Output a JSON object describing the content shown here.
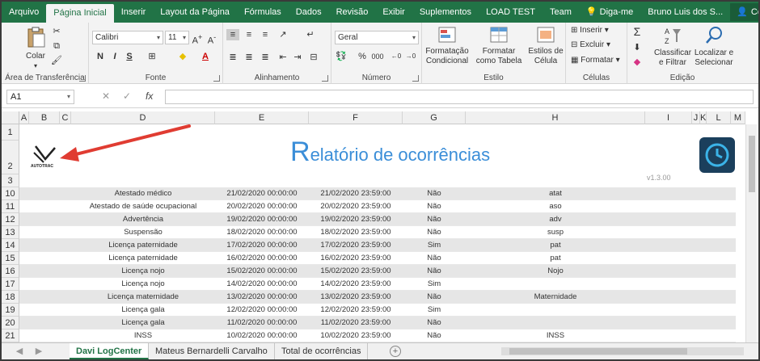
{
  "menu": {
    "tabs": [
      "Arquivo",
      "Página Inicial",
      "Inserir",
      "Layout da Página",
      "Fórmulas",
      "Dados",
      "Revisão",
      "Exibir",
      "Suplementos",
      "LOAD TEST",
      "Team"
    ],
    "tell_me": "Diga-me",
    "user": "Bruno Luis dos S...",
    "share": "Compartilhar"
  },
  "ribbon": {
    "clipboard": {
      "paste": "Colar",
      "label": "Área de Transferência"
    },
    "font": {
      "name": "Calibri",
      "size": "11",
      "bold": "N",
      "italic": "I",
      "underline": "S",
      "label": "Fonte"
    },
    "alignment": {
      "label": "Alinhamento"
    },
    "number": {
      "format": "Geral",
      "percent": "%",
      "thousands": "000",
      "label": "Número"
    },
    "styles": {
      "conditional": "Formatação Condicional",
      "table": "Formatar como Tabela",
      "cell": "Estilos de Célula",
      "label": "Estilo"
    },
    "cells": {
      "insert": "Inserir",
      "delete": "Excluir",
      "format": "Formatar",
      "label": "Células"
    },
    "editing": {
      "sort": "Classificar e Filtrar",
      "find": "Localizar e Selecionar",
      "label": "Edição"
    }
  },
  "formula_bar": {
    "name_box": "A1",
    "fx": "fx",
    "value": ""
  },
  "columns": [
    "A",
    "B",
    "C",
    "D",
    "E",
    "F",
    "G",
    "H",
    "I",
    "J",
    "K",
    "L",
    "M"
  ],
  "report": {
    "title_first": "R",
    "title_rest": "elatório de ocorrências",
    "version": "v1.3.00",
    "logo_text": "AUTOTRAC"
  },
  "header_rows": [
    "1",
    "2",
    "3"
  ],
  "rows": [
    {
      "n": "10",
      "d": "Atestado médico",
      "e": "21/02/2020 00:00:00",
      "f": "21/02/2020 23:59:00",
      "g": "Não",
      "h": "atat"
    },
    {
      "n": "11",
      "d": "Atestado de saúde ocupacional",
      "e": "20/02/2020 00:00:00",
      "f": "20/02/2020 23:59:00",
      "g": "Não",
      "h": "aso"
    },
    {
      "n": "12",
      "d": "Advertência",
      "e": "19/02/2020 00:00:00",
      "f": "19/02/2020 23:59:00",
      "g": "Não",
      "h": "adv"
    },
    {
      "n": "13",
      "d": "Suspensão",
      "e": "18/02/2020 00:00:00",
      "f": "18/02/2020 23:59:00",
      "g": "Não",
      "h": "susp"
    },
    {
      "n": "14",
      "d": "Licença paternidade",
      "e": "17/02/2020 00:00:00",
      "f": "17/02/2020 23:59:00",
      "g": "Sim",
      "h": "pat"
    },
    {
      "n": "15",
      "d": "Licença paternidade",
      "e": "16/02/2020 00:00:00",
      "f": "16/02/2020 23:59:00",
      "g": "Não",
      "h": "pat"
    },
    {
      "n": "16",
      "d": "Licença nojo",
      "e": "15/02/2020 00:00:00",
      "f": "15/02/2020 23:59:00",
      "g": "Não",
      "h": "Nojo"
    },
    {
      "n": "17",
      "d": "Licença nojo",
      "e": "14/02/2020 00:00:00",
      "f": "14/02/2020 23:59:00",
      "g": "Sim",
      "h": ""
    },
    {
      "n": "18",
      "d": "Licença maternidade",
      "e": "13/02/2020 00:00:00",
      "f": "13/02/2020 23:59:00",
      "g": "Não",
      "h": "Maternidade"
    },
    {
      "n": "19",
      "d": "Licença gala",
      "e": "12/02/2020 00:00:00",
      "f": "12/02/2020 23:59:00",
      "g": "Sim",
      "h": ""
    },
    {
      "n": "20",
      "d": "Licença gala",
      "e": "11/02/2020 00:00:00",
      "f": "11/02/2020 23:59:00",
      "g": "Não",
      "h": ""
    },
    {
      "n": "21",
      "d": "INSS",
      "e": "10/02/2020 00:00:00",
      "f": "10/02/2020 23:59:00",
      "g": "Não",
      "h": "INSS"
    }
  ],
  "sheets": [
    "Davi LogCenter",
    "Mateus Bernardelli Carvalho",
    "Total de ocorrências"
  ],
  "colors": {
    "excel_green": "#217346",
    "title_blue": "#3b8ed8",
    "arrow_red": "#e03c32"
  }
}
